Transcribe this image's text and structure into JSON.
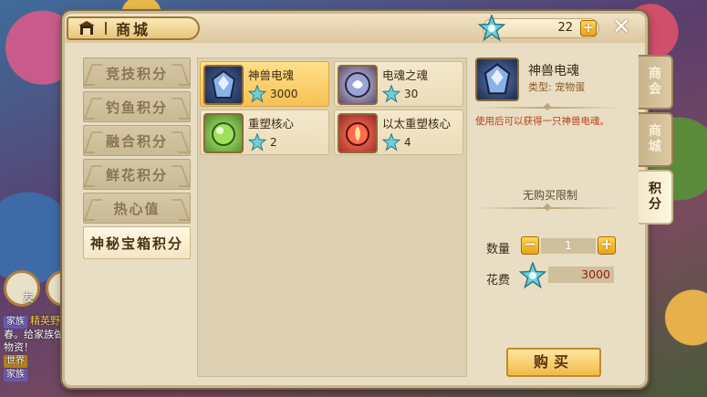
{
  "window": {
    "title": "商城"
  },
  "currency": {
    "value": "22"
  },
  "categories": [
    {
      "label": "竞技积分"
    },
    {
      "label": "钓鱼积分"
    },
    {
      "label": "融合积分"
    },
    {
      "label": "鲜花积分"
    },
    {
      "label": "热心值"
    },
    {
      "label": "神秘宝箱积分"
    }
  ],
  "items": [
    {
      "name": "神兽电魂",
      "price": "3000"
    },
    {
      "name": "电魂之魂",
      "price": "30"
    },
    {
      "name": "重塑核心",
      "price": "2"
    },
    {
      "name": "以太重塑核心",
      "price": "4"
    }
  ],
  "detail": {
    "name": "神兽电魂",
    "type": "类型:  宠物蛋",
    "description": "使用后可以获得一只神兽电魂。",
    "limit": "无购买限制",
    "quantity_label": "数量",
    "quantity": "1",
    "cost_label": "花费",
    "cost": "3000",
    "buy_label": "购买"
  },
  "side_tabs": [
    {
      "label": "商会"
    },
    {
      "label": "商城"
    },
    {
      "label": "积分"
    }
  ],
  "background_chat": {
    "tag1": "家族",
    "name1": "精英野",
    "line2": "春。给家族做",
    "line3": "物资！",
    "tag2": "世界",
    "tag3": "家族",
    "avatar_label": "友"
  },
  "colors": {
    "accent": "#f6c156",
    "price_red": "#a01818"
  }
}
